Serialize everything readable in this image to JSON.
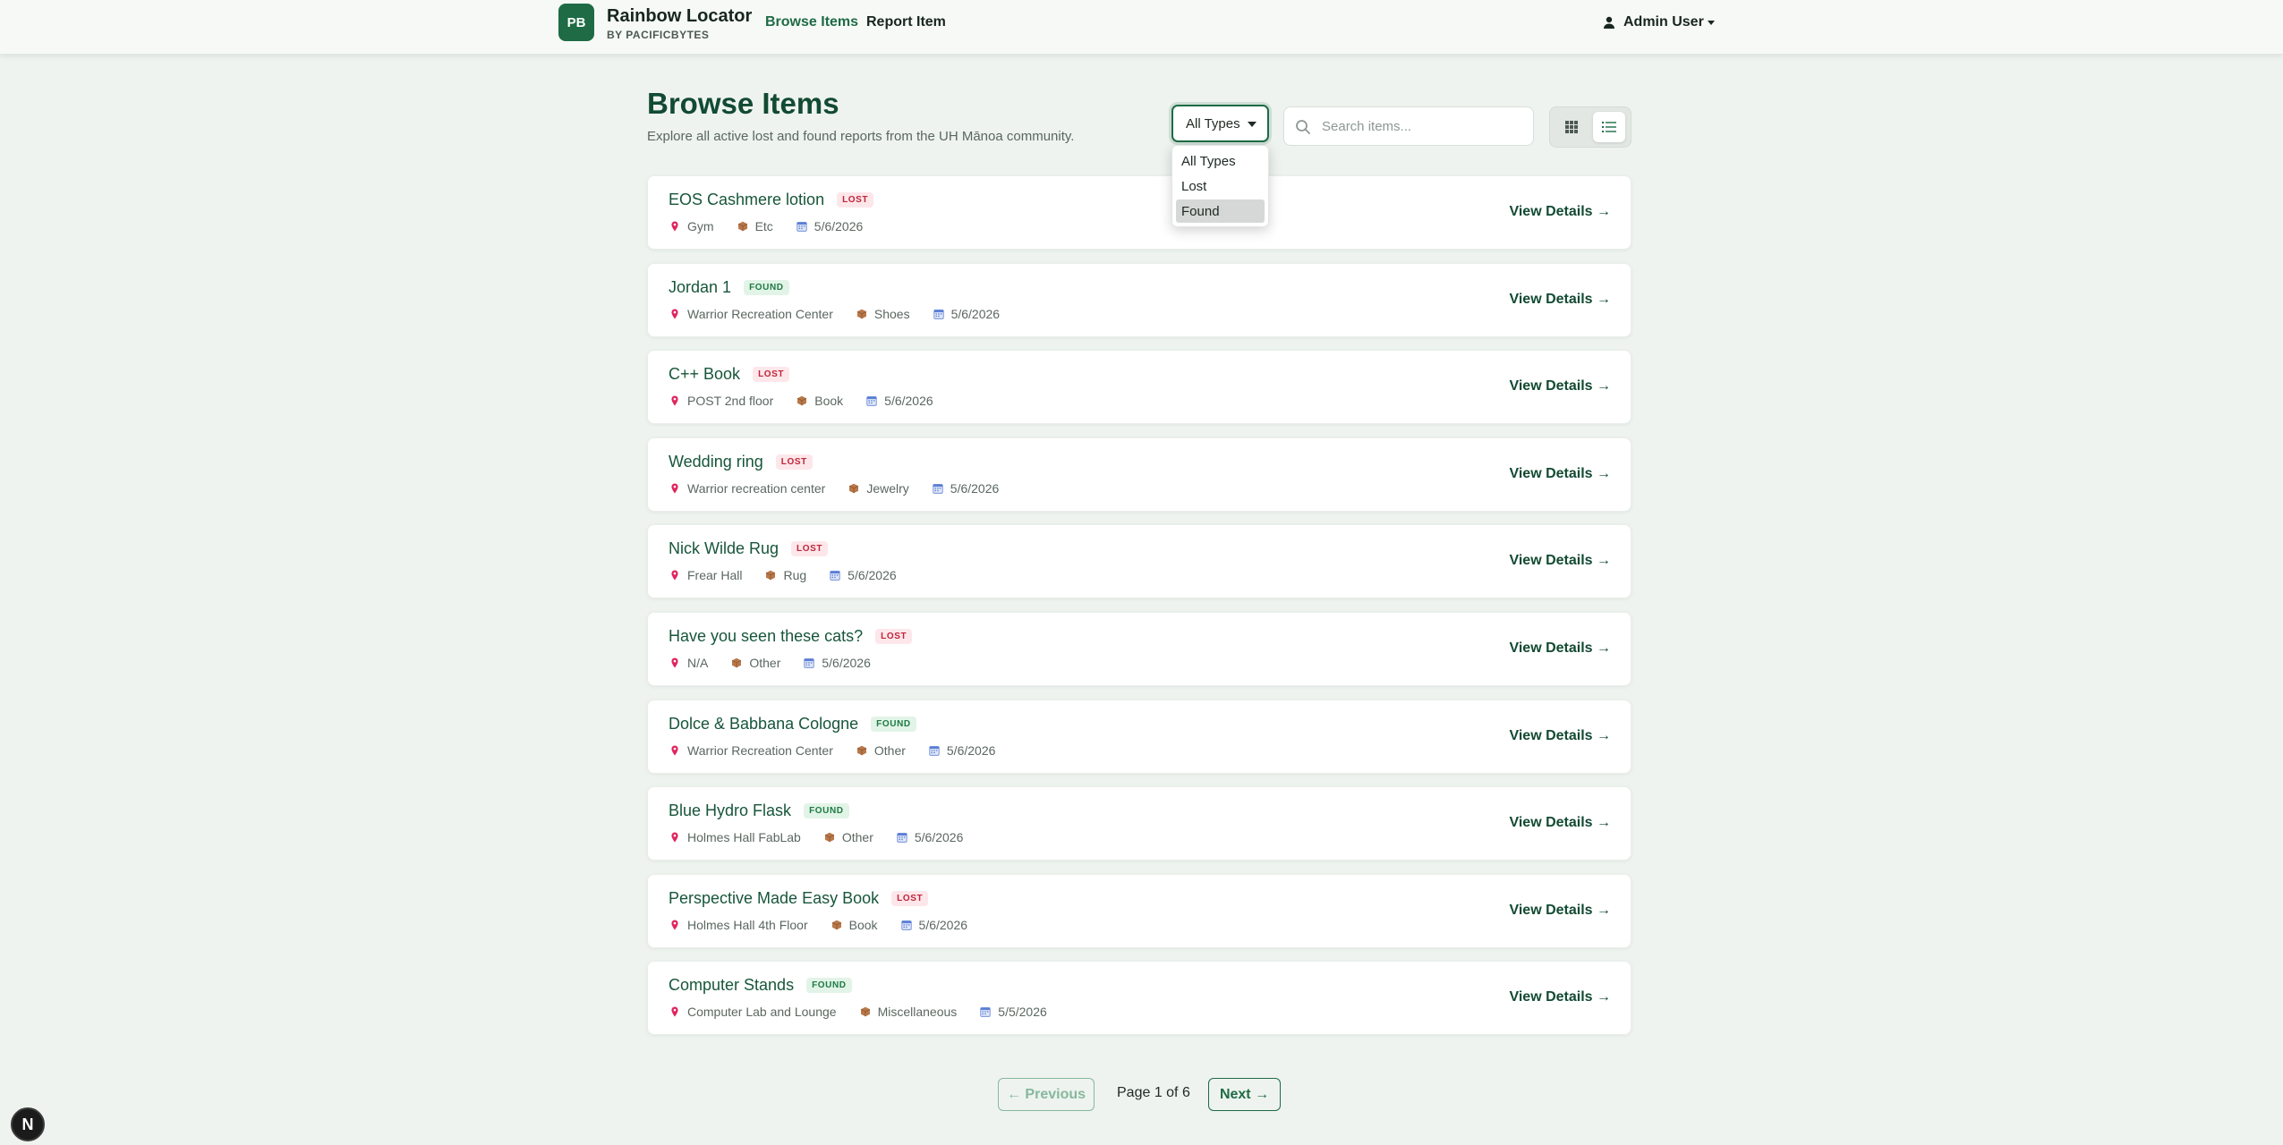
{
  "navbar": {
    "logo_initials": "PB",
    "brand_name": "Rainbow Locator",
    "brand_sub": "BY PACIFICBYTES",
    "links": [
      "Browse Items",
      "Report Item"
    ],
    "user": "Admin User"
  },
  "header": {
    "title": "Browse Items",
    "subtitle": "Explore all active lost and found reports from the UH Mānoa community."
  },
  "filter": {
    "selected": "All Types",
    "options": [
      "All Types",
      "Lost",
      "Found"
    ],
    "highlighted": "Found"
  },
  "search": {
    "placeholder": "Search items..."
  },
  "colors": {
    "accent": "#1e6b45",
    "lost_badge": "#c0253b",
    "found_badge": "#1e7a44",
    "background": "#eef3ef"
  },
  "items": [
    {
      "title": "EOS Cashmere lotion",
      "status": "LOST",
      "location": "Gym",
      "category": "Etc",
      "date": "5/6/2026",
      "action": "View Details →"
    },
    {
      "title": "Jordan 1",
      "status": "FOUND",
      "location": "Warrior Recreation Center",
      "category": "Shoes",
      "date": "5/6/2026",
      "action": "View Details →"
    },
    {
      "title": "C++ Book",
      "status": "LOST",
      "location": "POST 2nd floor",
      "category": "Book",
      "date": "5/6/2026",
      "action": "View Details →"
    },
    {
      "title": "Wedding ring",
      "status": "LOST",
      "location": "Warrior recreation center",
      "category": "Jewelry",
      "date": "5/6/2026",
      "action": "View Details →"
    },
    {
      "title": "Nick Wilde Rug",
      "status": "LOST",
      "location": "Frear Hall",
      "category": "Rug",
      "date": "5/6/2026",
      "action": "View Details →"
    },
    {
      "title": "Have you seen these cats?",
      "status": "LOST",
      "location": "N/A",
      "category": "Other",
      "date": "5/6/2026",
      "action": "View Details →"
    },
    {
      "title": "Dolce & Babbana Cologne",
      "status": "FOUND",
      "location": "Warrior Recreation Center",
      "category": "Other",
      "date": "5/6/2026",
      "action": "View Details →"
    },
    {
      "title": "Blue Hydro Flask",
      "status": "FOUND",
      "location": "Holmes Hall FabLab",
      "category": "Other",
      "date": "5/6/2026",
      "action": "View Details →"
    },
    {
      "title": "Perspective Made Easy Book",
      "status": "LOST",
      "location": "Holmes Hall 4th Floor",
      "category": "Book",
      "date": "5/6/2026",
      "action": "View Details →"
    },
    {
      "title": "Computer Stands",
      "status": "FOUND",
      "location": "Computer Lab and Lounge",
      "category": "Miscellaneous",
      "date": "5/5/2026",
      "action": "View Details →"
    }
  ],
  "pagination": {
    "prev_label": "← Previous",
    "info": "Page 1 of 6",
    "next_label": "Next →"
  },
  "dev_badge": "N",
  "icons": {
    "location": "pin-icon",
    "category": "package-icon",
    "date": "calendar-icon",
    "search": "search-icon",
    "grid_view": "grid-icon",
    "list_view": "list-icon",
    "user": "user-icon"
  }
}
